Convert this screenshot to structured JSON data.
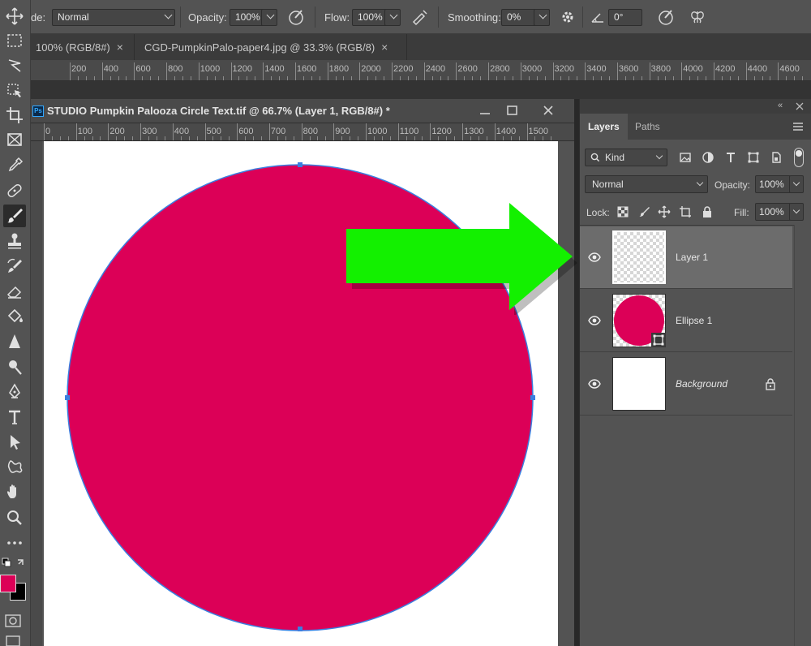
{
  "options_bar": {
    "mode_label": "de:",
    "mode_value": "Normal",
    "opacity_label": "Opacity:",
    "opacity_value": "100%",
    "flow_label": "Flow:",
    "flow_value": "100%",
    "smoothing_label": "Smoothing:",
    "smoothing_value": "0%",
    "angle_value": "0°"
  },
  "tabs": [
    {
      "label": "100% (RGB/8#)"
    },
    {
      "label": "CGD-PumpkinPalo-paper4.jpg @ 33.3% (RGB/8)"
    }
  ],
  "tab_close": "×",
  "bg_ruler": [
    "200",
    "400",
    "600",
    "800",
    "1000",
    "1200",
    "1400",
    "1600",
    "1800",
    "2000",
    "2200",
    "2400",
    "2600",
    "2800",
    "3000",
    "3200",
    "3400",
    "3600",
    "3800",
    "4000",
    "4200",
    "4400",
    "4600"
  ],
  "document": {
    "title": "STUDIO Pumpkin Palooza Circle Text.tif @ 66.7% (Layer 1, RGB/8#) *",
    "ps_badge": "Ps",
    "ruler": [
      "0",
      "100",
      "200",
      "300",
      "400",
      "500",
      "600",
      "700",
      "800",
      "900",
      "1000",
      "1100",
      "1200",
      "1300",
      "1400",
      "1500"
    ]
  },
  "colors": {
    "circle_fill": "#dc0057",
    "circle_stroke": "#3a7fe0",
    "arrow": "#13f000",
    "foreground_swatch": "#dc0057",
    "background_swatch": "#000000"
  },
  "layers_panel": {
    "tabs": [
      {
        "label": "Layers"
      },
      {
        "label": "Paths"
      }
    ],
    "filter_value": "Kind",
    "blend_mode": "Normal",
    "opacity_label": "Opacity:",
    "opacity_value": "100%",
    "lock_label": "Lock:",
    "fill_label": "Fill:",
    "fill_value": "100%",
    "layers": [
      {
        "name": "Layer 1"
      },
      {
        "name": "Ellipse 1"
      },
      {
        "name": "Background"
      }
    ]
  }
}
